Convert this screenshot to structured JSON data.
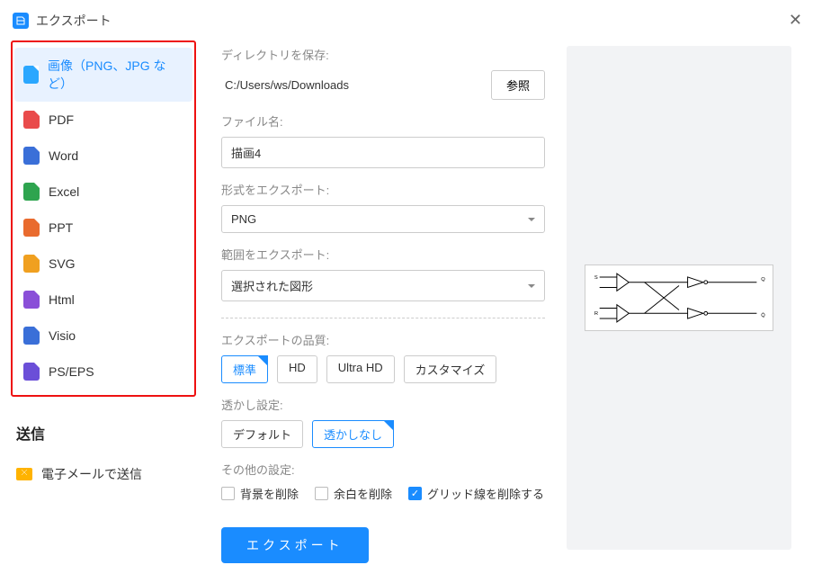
{
  "title": "エクスポート",
  "formats": [
    {
      "label": "画像（PNG、JPG など）",
      "color": "#2aa7ff",
      "selected": true
    },
    {
      "label": "PDF",
      "color": "#e94b4b"
    },
    {
      "label": "Word",
      "color": "#3a6fd8"
    },
    {
      "label": "Excel",
      "color": "#2ea44f"
    },
    {
      "label": "PPT",
      "color": "#e96b2e"
    },
    {
      "label": "SVG",
      "color": "#f0a020"
    },
    {
      "label": "Html",
      "color": "#8a4fd8"
    },
    {
      "label": "Visio",
      "color": "#3a6fd8"
    },
    {
      "label": "PS/EPS",
      "color": "#6b4fd8"
    }
  ],
  "send_heading": "送信",
  "send_email": "電子メールで送信",
  "labels": {
    "directory": "ディレクトリを保存:",
    "filename": "ファイル名:",
    "format": "形式をエクスポート:",
    "range": "範囲をエクスポート:",
    "quality": "エクスポートの品質:",
    "watermark": "透かし設定:",
    "other": "その他の設定:"
  },
  "path": "C:/Users/ws/Downloads",
  "browse": "参照",
  "filename": "描画4",
  "format_sel": "PNG",
  "range_sel": "選択された図形",
  "quality": [
    "標準",
    "HD",
    "Ultra HD",
    "カスタマイズ"
  ],
  "quality_sel": 0,
  "watermark": [
    "デフォルト",
    "透かしなし"
  ],
  "watermark_sel": 1,
  "checks": {
    "bg": "背景を削除",
    "margin": "余白を削除",
    "grid": "グリッド線を削除する"
  },
  "grid_on": true,
  "export_btn": "エクスポート"
}
